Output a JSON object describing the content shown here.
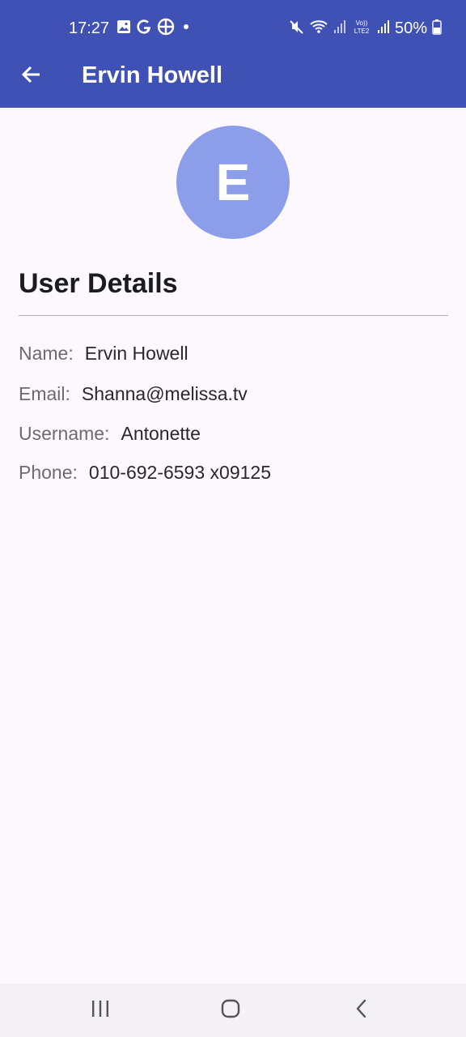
{
  "status_bar": {
    "time": "17:27",
    "battery": "50%",
    "left_icons": [
      "gallery-icon",
      "google-icon",
      "app-icon",
      "dot-icon"
    ],
    "right_icons": [
      "mute-icon",
      "wifi-icon",
      "signal-icon",
      "volte-icon",
      "signal-icon",
      "battery-icon"
    ]
  },
  "app_bar": {
    "title": "Ervin Howell",
    "back_icon": "arrow-left-icon",
    "color": "#3f51b5"
  },
  "avatar": {
    "initial": "E",
    "color": "#8c9eea"
  },
  "details": {
    "heading": "User Details",
    "rows": [
      {
        "label": "Name:",
        "value": "Ervin Howell"
      },
      {
        "label": "Email:",
        "value": "Shanna@melissa.tv"
      },
      {
        "label": "Username:",
        "value": "Antonette"
      },
      {
        "label": "Phone:",
        "value": "010-692-6593 x09125"
      }
    ]
  },
  "nav_bar": {
    "buttons": [
      "recent-apps-icon",
      "home-icon",
      "back-icon"
    ]
  }
}
